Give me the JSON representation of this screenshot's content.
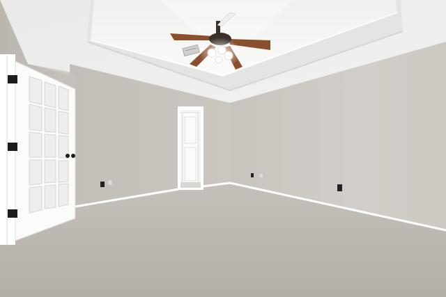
{
  "scene": {
    "kind": "photo",
    "subject": "empty-bedroom",
    "elements": [
      "tray-ceiling",
      "ceiling-fan",
      "french-door",
      "open-doorway",
      "carpet",
      "baseboards",
      "outlets",
      "hvac-vent"
    ],
    "colors": {
      "wall_left": "#c7c1bb",
      "wall_right": "#cfcac5",
      "back_wall": "#c9c3bd",
      "ceiling": "#eeeeec",
      "tray": "#f3f3f1",
      "carpet": "#bdb7b1",
      "trim": "#ffffff",
      "fan_blade": "#8a4f2c",
      "fan_hardware": "#3a2f29",
      "hinge": "#1c1c1c"
    }
  }
}
